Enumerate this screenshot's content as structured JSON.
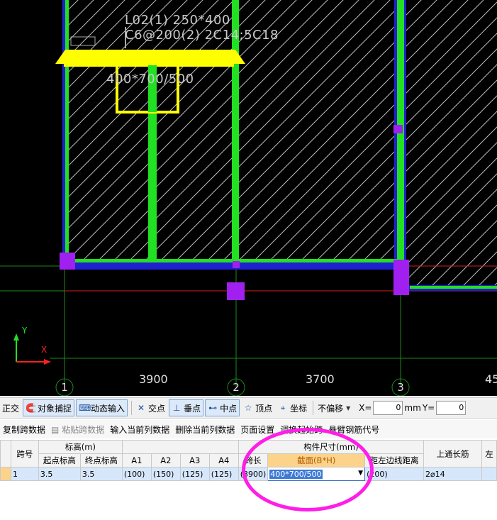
{
  "canvas": {
    "beam_label_line1": "L02(1) 250*400",
    "beam_label_line2": "C6@200(2) 2C14;5C18",
    "section_label": "400*700/500",
    "dimensions": [
      "3900",
      "3700",
      "45"
    ],
    "axes": [
      "1",
      "2",
      "3"
    ],
    "ucs_y": "Y",
    "ucs_x": "X"
  },
  "snapbar": {
    "ortho": "正交",
    "object_snap": "对象捕捉",
    "dynamic_input": "动态输入",
    "intersection": "交点",
    "perpendicular": "垂点",
    "midpoint": "中点",
    "vertex": "顶点",
    "coordinate": "坐标",
    "offset_select": "不偏移",
    "x_label": "X=",
    "x_value": "0",
    "mm_label": "mm",
    "y_label": "Y=",
    "y_value": "0"
  },
  "toolbar": {
    "copy_span": "复制跨数据",
    "paste_span": "粘贴跨数据",
    "input_column": "输入当前列数据",
    "delete_column": "删除当前列数据",
    "page_setup": "页面设置",
    "swap_support": "调换起始跨",
    "cantilever_code": "悬臂钢筋代号"
  },
  "table": {
    "headers_top": {
      "span_no": "跨号",
      "elevation": "标高(m)",
      "dimensions": "构件尺寸(mm)",
      "top_rebar": "上通长筋",
      "left": "左"
    },
    "headers_sub": {
      "start_elev": "起点标高",
      "end_elev": "终点标高",
      "a1": "A1",
      "a2": "A2",
      "a3": "A3",
      "a4": "A4",
      "span_len": "跨长",
      "section": "截面(B*H)",
      "left_edge": "距左边线距离"
    },
    "row": {
      "span_no": "1",
      "start_elev": "3.5",
      "end_elev": "3.5",
      "a1": "(100)",
      "a2": "(150)",
      "a3": "(125)",
      "a4": "(125)",
      "span_len": "(3900)",
      "section": "400*700/500",
      "left_edge": "(200)",
      "top_rebar": "2⌀14"
    }
  }
}
